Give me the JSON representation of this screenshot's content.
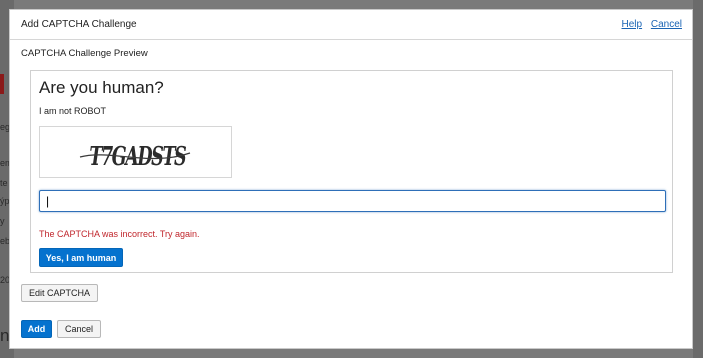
{
  "dialog": {
    "title": "Add CAPTCHA Challenge",
    "help_link": "Help",
    "cancel_link": "Cancel"
  },
  "preview": {
    "section_title": "CAPTCHA Challenge Preview",
    "heading": "Are you human?",
    "subtext": "I am not ROBOT",
    "captcha_text": "T7GADSTS",
    "answer_value": "|",
    "error_message": "The CAPTCHA was incorrect. Try again.",
    "confirm_button": "Yes, I am human"
  },
  "actions": {
    "edit_button": "Edit CAPTCHA",
    "add_button": "Add",
    "cancel_button": "Cancel"
  },
  "background_fragments": [
    "eg",
    "em",
    "te",
    "ýp",
    "y",
    "eb",
    "20",
    "nt"
  ],
  "colors": {
    "primary_button": "#0572ce",
    "link": "#1a64b4",
    "error": "#c0262c",
    "overlay": "#5f5f5f"
  }
}
